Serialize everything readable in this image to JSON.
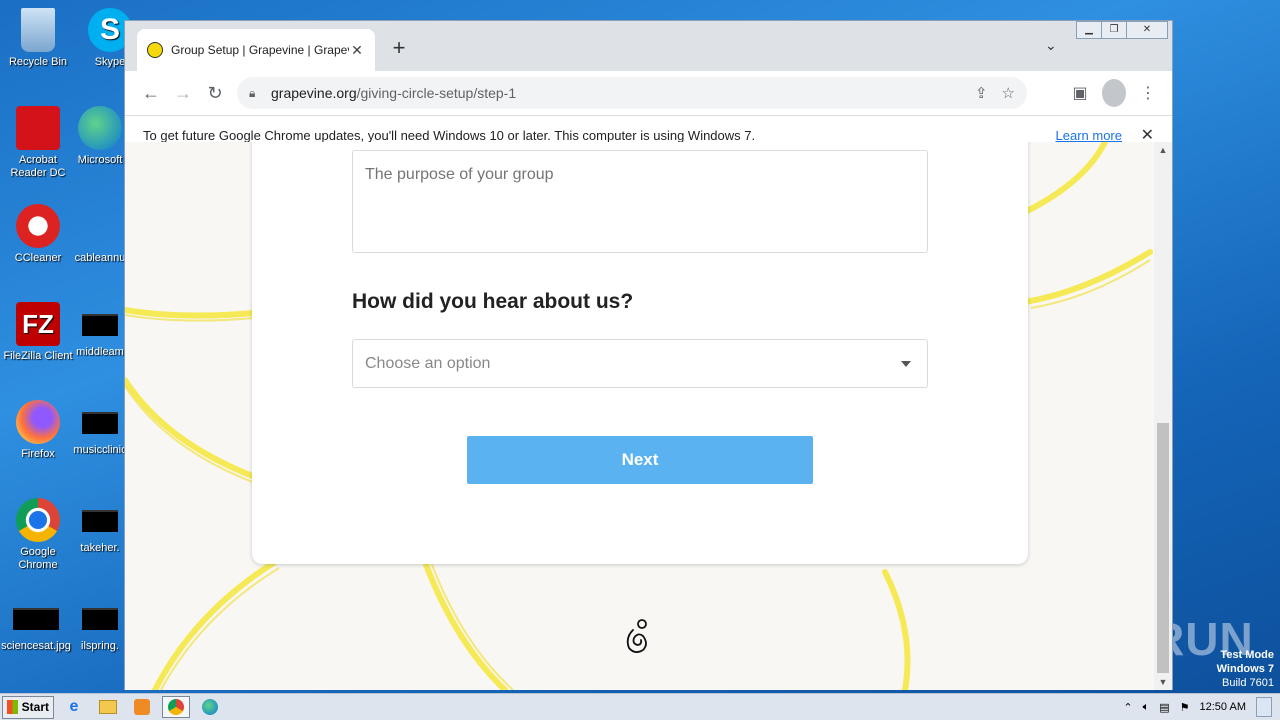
{
  "desktop": {
    "icons": [
      {
        "label": "Recycle Bin"
      },
      {
        "label": "Skype"
      },
      {
        "label": "Acrobat Reader DC"
      },
      {
        "label": "Microsoft"
      },
      {
        "label": "CCleaner"
      },
      {
        "label": "cableannu"
      },
      {
        "label": "FileZilla Client"
      },
      {
        "label": "middleam"
      },
      {
        "label": "Firefox"
      },
      {
        "label": "musicclinic"
      },
      {
        "label": "Google Chrome"
      },
      {
        "label": "takeher."
      },
      {
        "label": "sciencesat.jpg"
      },
      {
        "label": "ilspring."
      }
    ]
  },
  "browser": {
    "tab_title": "Group Setup | Grapevine | Grapevine",
    "url_host": "grapevine.org",
    "url_path": "/giving-circle-setup/step-1",
    "infobar_text": "To get future Google Chrome updates, you'll need Windows 10 or later. This computer is using Windows 7.",
    "infobar_link": "Learn more"
  },
  "form": {
    "purpose_placeholder": "The purpose of your group",
    "question": "How did you hear about us?",
    "select_placeholder": "Choose an option",
    "next_label": "Next"
  },
  "taskbar": {
    "start_label": "Start",
    "clock": "12:50 AM"
  },
  "watermark": {
    "line1": "Test Mode",
    "line2": "Windows 7",
    "line3": "Build 7601",
    "brand": "ANY RUN"
  },
  "colors": {
    "accent_button": "#5ab2f0",
    "page_bg": "#f9f7f4",
    "deco_yellow": "#f5e83a"
  }
}
